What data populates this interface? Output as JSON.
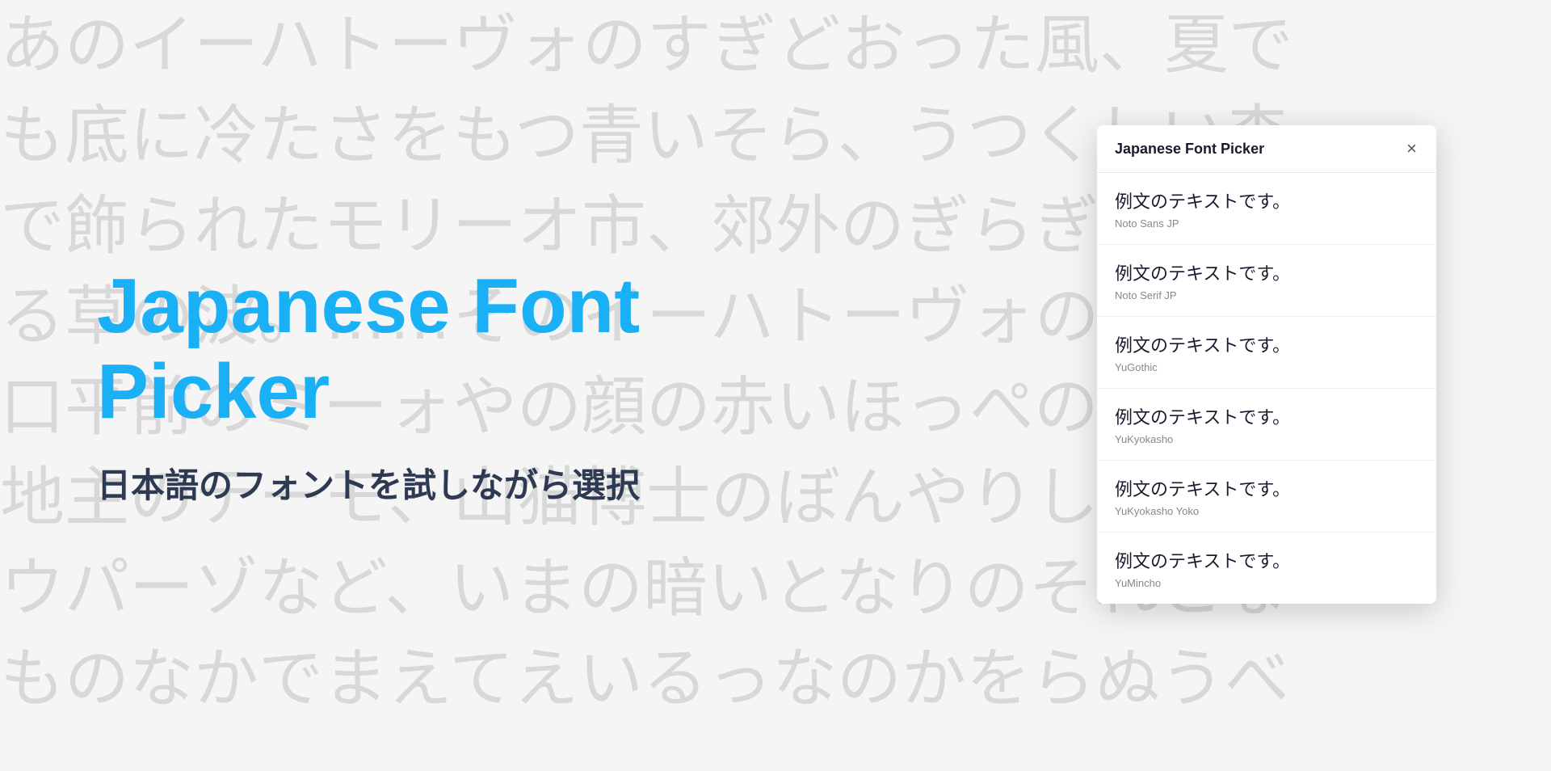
{
  "background": {
    "lines": [
      "あのイーハトーヴォのすぎどおった風、夏で",
      "も底に冷たさをもつ青いそら、うつくしい森",
      "で飾られたモリーオ市、郊外のぎらぎらひか",
      "る草の波。……そのイーハトーヴォのきれいな",
      "口平前のミーォやの顔の赤いほっぺのあとを",
      "地主のテーモ、山猫博士のぼんやりしたもの",
      "ウパーゾなど、いまの暗いとなりのそれとな",
      "ものなかでまえてえいるっなのかをらぬうべ"
    ]
  },
  "hero": {
    "title": "Japanese Font Picker",
    "subtitle": "日本語のフォントを試しながら選択"
  },
  "panel": {
    "title": "Japanese Font Picker",
    "close_label": "×",
    "fonts": [
      {
        "sample": "例文のテキストです。",
        "name": "Noto Sans JP",
        "family": "sans-serif"
      },
      {
        "sample": "例文のテキストです。",
        "name": "Noto Serif JP",
        "family": "serif"
      },
      {
        "sample": "例文のテキストです。",
        "name": "YuGothic",
        "family": "YuGothic, sans-serif"
      },
      {
        "sample": "例文のテキストです。",
        "name": "YuKyokasho",
        "family": "YuKyokasho, cursive"
      },
      {
        "sample": "例文のテキストです。",
        "name": "YuKyokasho Yoko",
        "family": "YuKyokasho Yoko, cursive"
      },
      {
        "sample": "例文のテキストです。",
        "name": "YuMincho",
        "family": "YuMincho, serif"
      }
    ]
  }
}
